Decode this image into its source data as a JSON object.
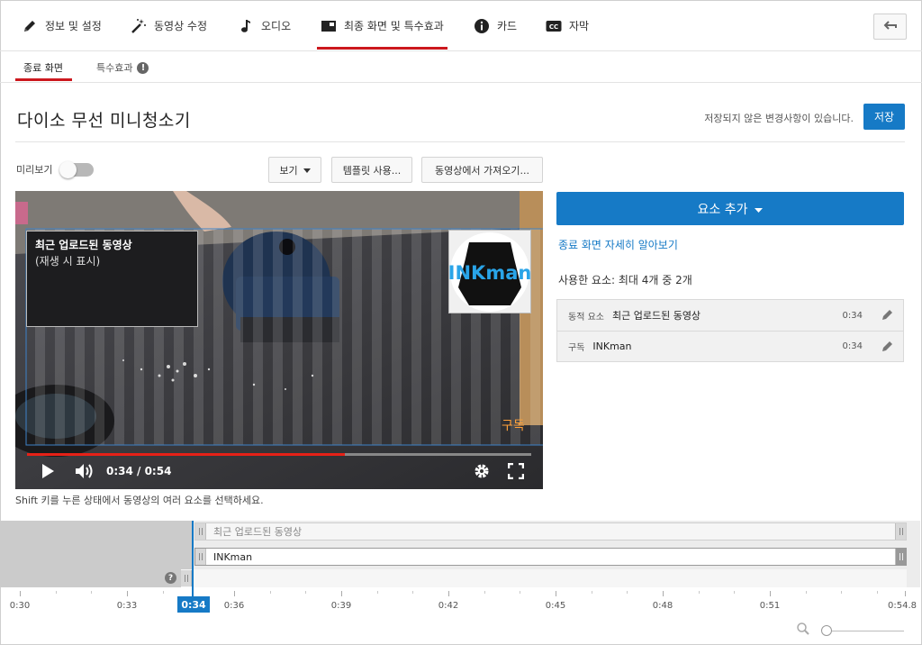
{
  "nav": {
    "tabs": [
      {
        "label": "정보 및 설정",
        "icon": "pencil-icon"
      },
      {
        "label": "동영상 수정",
        "icon": "magic-wand-icon"
      },
      {
        "label": "오디오",
        "icon": "music-note-icon"
      },
      {
        "label": "최종 화면 및 특수효과",
        "icon": "end-screen-icon",
        "active": true
      },
      {
        "label": "카드",
        "icon": "info-icon"
      },
      {
        "label": "자막",
        "icon": "cc-icon"
      }
    ],
    "back_icon": "back-arrow-icon"
  },
  "subnav": {
    "tabs": [
      {
        "label": "종료 화면",
        "active": true
      },
      {
        "label": "특수효과",
        "info": "!"
      }
    ]
  },
  "header": {
    "title": "다이소 무선 미니청소기",
    "unsaved": "저장되지 않은 변경사항이 있습니다.",
    "save_label": "저장"
  },
  "toolbar": {
    "preview_label": "미리보기",
    "preview_on": false,
    "view_label": "보기",
    "template_label": "템플릿 사용...",
    "import_label": "동영상에서 가져오기..."
  },
  "video": {
    "recent_title": "최근 업로드된 동영상",
    "recent_sub": "(재생 시 표시)",
    "channel_logo_text": "INKman",
    "watermark": "구독",
    "time": "0:34 / 0:54",
    "progress": 0.63
  },
  "hint": "Shift 키를 누른 상태에서 동영상의 여러 요소를 선택하세요.",
  "panel": {
    "add_label": "요소 추가",
    "learn_link": "종료 화면 자세히 알아보기",
    "used": "사용한 요소: 최대 4개 중 2개",
    "elements": [
      {
        "type": "동적 요소",
        "name": "최근 업로드된 동영상",
        "time": "0:34"
      },
      {
        "type": "구독",
        "name": "INKman",
        "time": "0:34"
      }
    ]
  },
  "timeline": {
    "tracks": [
      {
        "label": "최근 업로드된 동영상",
        "selected": false
      },
      {
        "label": "INKman",
        "selected": true
      }
    ],
    "help": "?",
    "playhead": "0:34",
    "ticks": [
      "0:30",
      "0:33",
      "0:36",
      "0:39",
      "0:42",
      "0:45",
      "0:48",
      "0:51",
      "0:54.8"
    ]
  },
  "colors": {
    "accent_red": "#cc181e",
    "accent_blue": "#167ac6"
  }
}
